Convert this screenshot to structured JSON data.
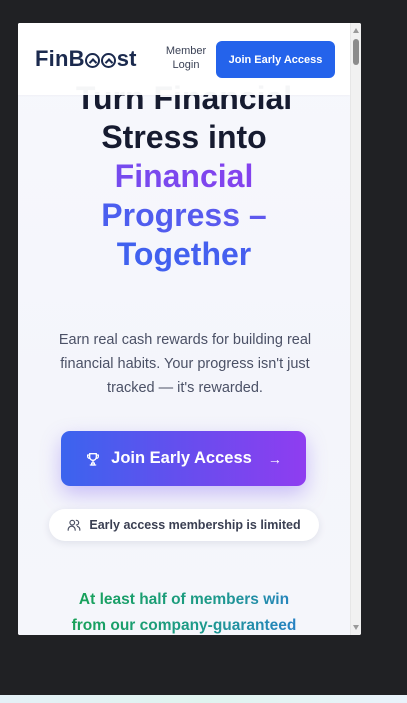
{
  "header": {
    "logo": {
      "prefix": "FinB",
      "suffix": "st"
    },
    "member_login": "Member Login",
    "join_button": "Join Early Access"
  },
  "hero": {
    "headline_dark": [
      "Turn Financial",
      "Stress into"
    ],
    "headline_gradient": [
      "Financial",
      "Progress –",
      "Together"
    ],
    "subtitle": "Earn real cash rewards for building real financial habits. Your progress isn't just tracked — it's rewarded.",
    "cta_label": "Join Early Access",
    "cta_icon": "trophy-icon",
    "cta_arrow": "→",
    "limited_badge": "Early access membership is limited",
    "limited_icon": "users-icon",
    "note_lines": [
      "At least half of members win",
      "from our company-guaranteed"
    ]
  },
  "colors": {
    "header_button": "#2463eb",
    "cta_gradient_start": "#3b64ee",
    "cta_gradient_end": "#8f3df0",
    "headline_dark": "#161b30",
    "note_green": "#16a34a",
    "note_blue": "#2a79d8"
  }
}
